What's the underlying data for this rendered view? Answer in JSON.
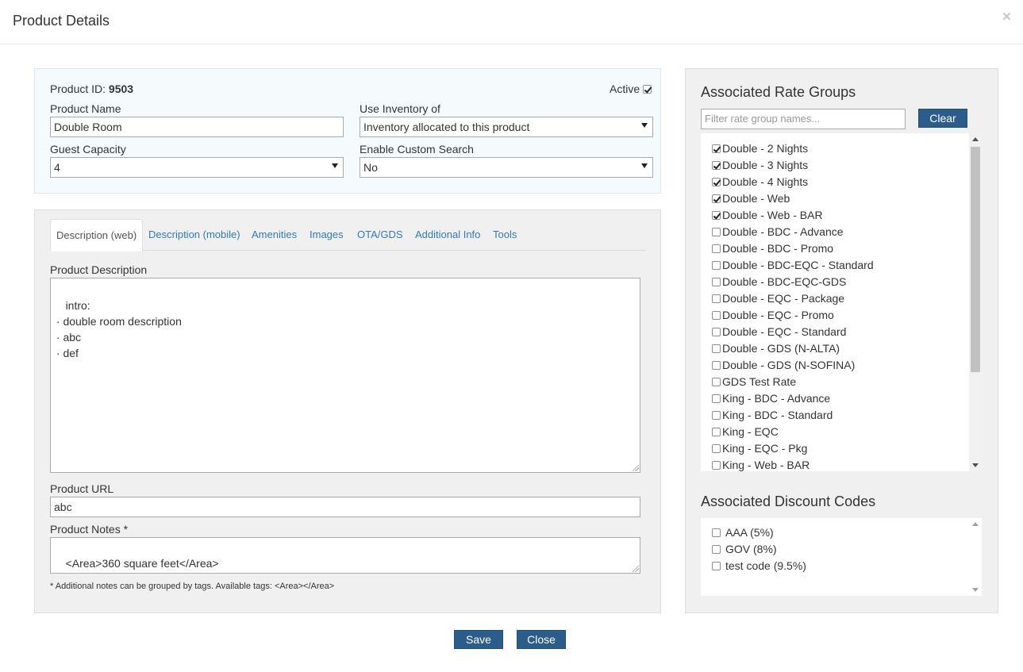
{
  "modal": {
    "title": "Product Details",
    "close_glyph": "×"
  },
  "product": {
    "id_label": "Product ID:",
    "id_value": "9503",
    "active_label": "Active",
    "active_checked": true,
    "name_label": "Product Name",
    "name_value": "Double Room",
    "inventory_label": "Use Inventory of",
    "inventory_value": "Inventory allocated to this product",
    "capacity_label": "Guest Capacity",
    "capacity_value": "4",
    "custom_search_label": "Enable Custom Search",
    "custom_search_value": "No"
  },
  "tabs": [
    {
      "label": "Description (web)",
      "active": true
    },
    {
      "label": "Description (mobile)",
      "active": false
    },
    {
      "label": "Amenities",
      "active": false
    },
    {
      "label": "Images",
      "active": false
    },
    {
      "label": "OTA/GDS",
      "active": false
    },
    {
      "label": "Additional Info",
      "active": false
    },
    {
      "label": "Tools",
      "active": false
    }
  ],
  "description": {
    "label": "Product Description",
    "value": "intro:\n · double room description\n · abc\n · def"
  },
  "url": {
    "label": "Product URL",
    "value": "abc"
  },
  "notes": {
    "label": "Product Notes *",
    "value": "<Area>360 square feet</Area>",
    "help": "* Additional notes can be grouped by tags. Available tags: <Area></Area>"
  },
  "rate_groups": {
    "title": "Associated Rate Groups",
    "filter_placeholder": "Filter rate group names...",
    "clear_label": "Clear",
    "items": [
      {
        "label": "Double - 2 Nights",
        "checked": true
      },
      {
        "label": "Double - 3 Nights",
        "checked": true
      },
      {
        "label": "Double - 4 Nights",
        "checked": true
      },
      {
        "label": "Double - Web",
        "checked": true
      },
      {
        "label": "Double - Web - BAR",
        "checked": true
      },
      {
        "label": "Double - BDC - Advance",
        "checked": false
      },
      {
        "label": "Double - BDC - Promo",
        "checked": false
      },
      {
        "label": "Double - BDC-EQC - Standard",
        "checked": false
      },
      {
        "label": "Double - BDC-EQC-GDS",
        "checked": false
      },
      {
        "label": "Double - EQC - Package",
        "checked": false
      },
      {
        "label": "Double - EQC - Promo",
        "checked": false
      },
      {
        "label": "Double - EQC - Standard",
        "checked": false
      },
      {
        "label": "Double - GDS (N-ALTA)",
        "checked": false
      },
      {
        "label": "Double - GDS (N-SOFINA)",
        "checked": false
      },
      {
        "label": "GDS Test Rate",
        "checked": false
      },
      {
        "label": "King - BDC - Advance",
        "checked": false
      },
      {
        "label": "King - BDC - Standard",
        "checked": false
      },
      {
        "label": "King - EQC",
        "checked": false
      },
      {
        "label": "King - EQC - Pkg",
        "checked": false
      },
      {
        "label": "King - Web - BAR",
        "checked": false
      }
    ]
  },
  "discount_codes": {
    "title": "Associated Discount Codes",
    "items": [
      {
        "label": "AAA (5%)",
        "checked": false
      },
      {
        "label": "GOV (8%)",
        "checked": false
      },
      {
        "label": "test code (9.5%)",
        "checked": false
      }
    ]
  },
  "footer": {
    "save_label": "Save",
    "close_label": "Close"
  },
  "colors": {
    "primary_button": "#2c5d8a",
    "link": "#337ab7"
  }
}
